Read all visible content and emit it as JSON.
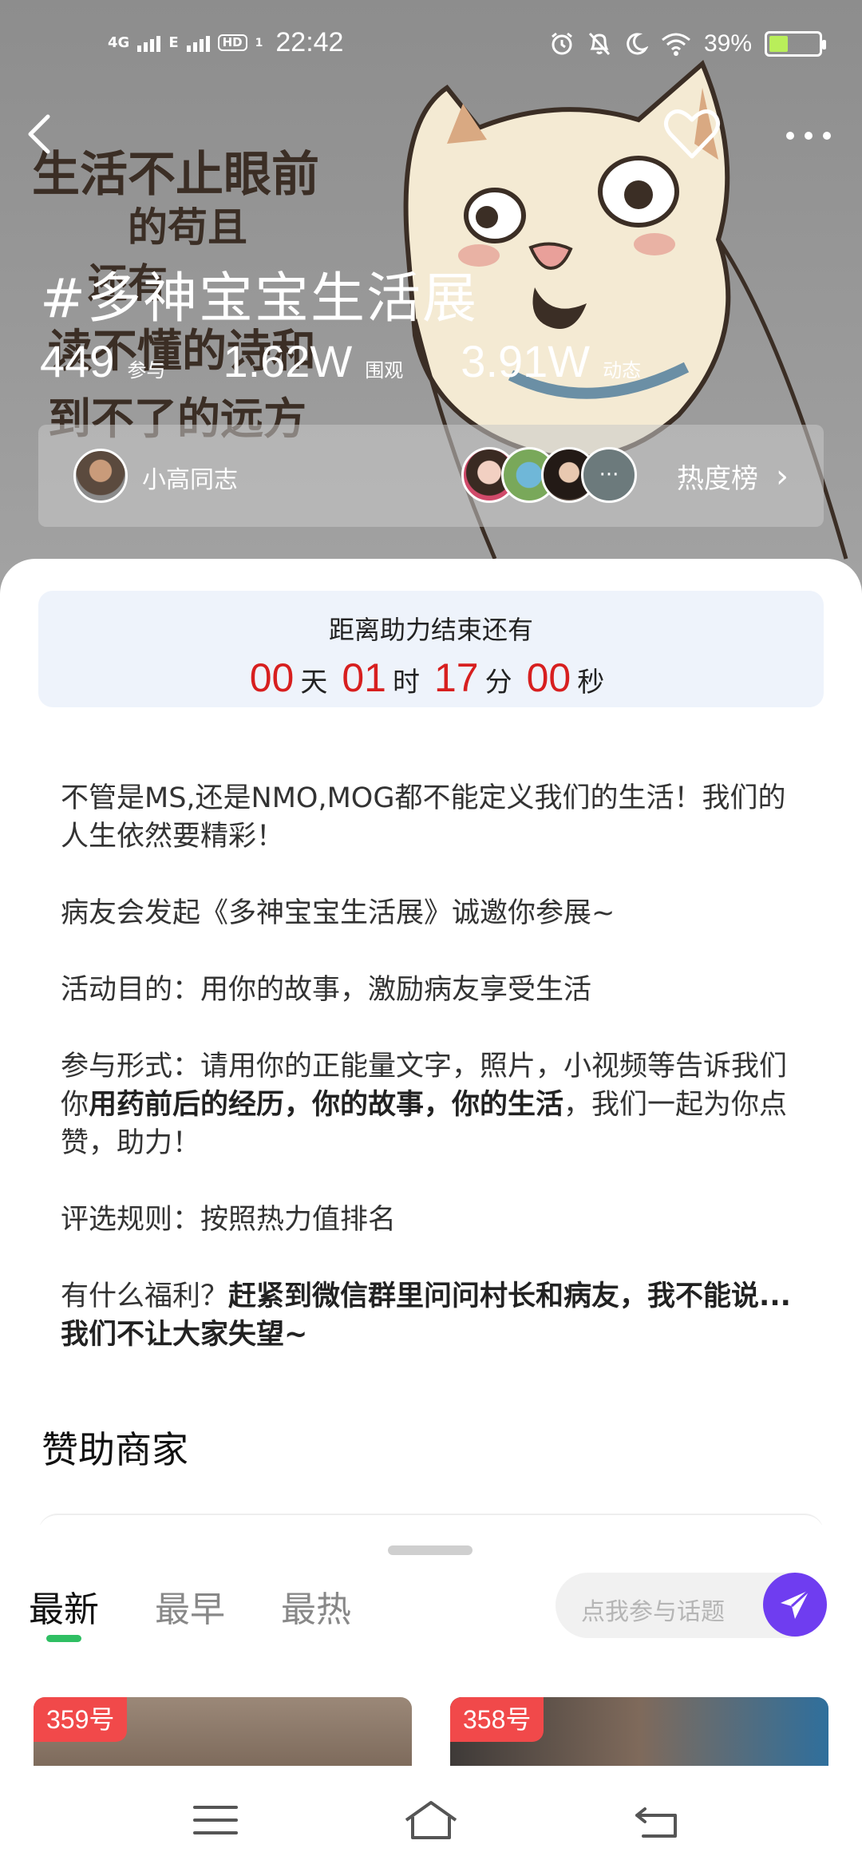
{
  "status_bar": {
    "signal_1": "4G",
    "signal_2": "E",
    "hd": "HD",
    "sim": "1",
    "time": "22:42",
    "battery": "39%",
    "battery_level": 0.39,
    "icons": [
      "alarm-icon",
      "mute-icon",
      "moon-icon",
      "wifi-icon",
      "battery-icon"
    ]
  },
  "nav": {
    "back_icon": "back-chevron-icon",
    "like_icon": "heart-outline-icon",
    "more_icon": "more-dots-icon"
  },
  "banner_art": {
    "lines": [
      "生活不止眼前",
      "的苟且",
      "还有",
      "读不懂的诗和",
      "到不了的远方"
    ]
  },
  "topic": {
    "title": "#多神宝宝生活展",
    "stats": [
      {
        "value": "449",
        "label": "参与"
      },
      {
        "value": "1.62W",
        "label": "围观"
      },
      {
        "value": "3.91W",
        "label": "动态"
      }
    ]
  },
  "creator": {
    "name": "小高同志",
    "more_label": "···",
    "heat_label": "热度榜",
    "arrow": "›"
  },
  "countdown": {
    "label": "距离助力结束还有",
    "days": "00",
    "days_unit": "天",
    "hours": "01",
    "hours_unit": "时",
    "minutes": "17",
    "minutes_unit": "分",
    "seconds": "00",
    "seconds_unit": "秒"
  },
  "description": {
    "p1": "不管是MS,还是NMO,MOG都不能定义我们的生活！我们的人生依然要精彩！",
    "p2": "病友会发起《多神宝宝生活展》诚邀你参展~",
    "p3": "活动目的：用你的故事，激励病友享受生活",
    "p4_a": "参与形式：请用你的正能量文字，照片，小视频等告诉我们你",
    "p4_b": "用药前后的经历，你的故事，你的生活",
    "p4_c": "，我们一起为你点赞，助力！",
    "p5": "评选规则：按照热力值排名",
    "p6_a": "有什么福利？",
    "p6_b": "赶紧到微信群里问问村长和病友，我不能说...我们不让大家失望~"
  },
  "sponsor": {
    "title": "赞助商家"
  },
  "tabs": [
    {
      "label": "最新",
      "active": true
    },
    {
      "label": "最早",
      "active": false
    },
    {
      "label": "最热",
      "active": false
    }
  ],
  "join": {
    "placeholder": "点我参与话题",
    "send_icon": "send-plane-icon"
  },
  "posts": [
    {
      "badge": "359号"
    },
    {
      "badge": "358号"
    }
  ],
  "system_nav": [
    "menu-icon",
    "home-icon",
    "back-icon"
  ],
  "colors": {
    "accent_red": "#d71f1f",
    "tab_indicator": "#2fbf63",
    "send_button": "#6f3df0",
    "badge": "#f1494a",
    "countdown_bg": "#eef3fb"
  }
}
